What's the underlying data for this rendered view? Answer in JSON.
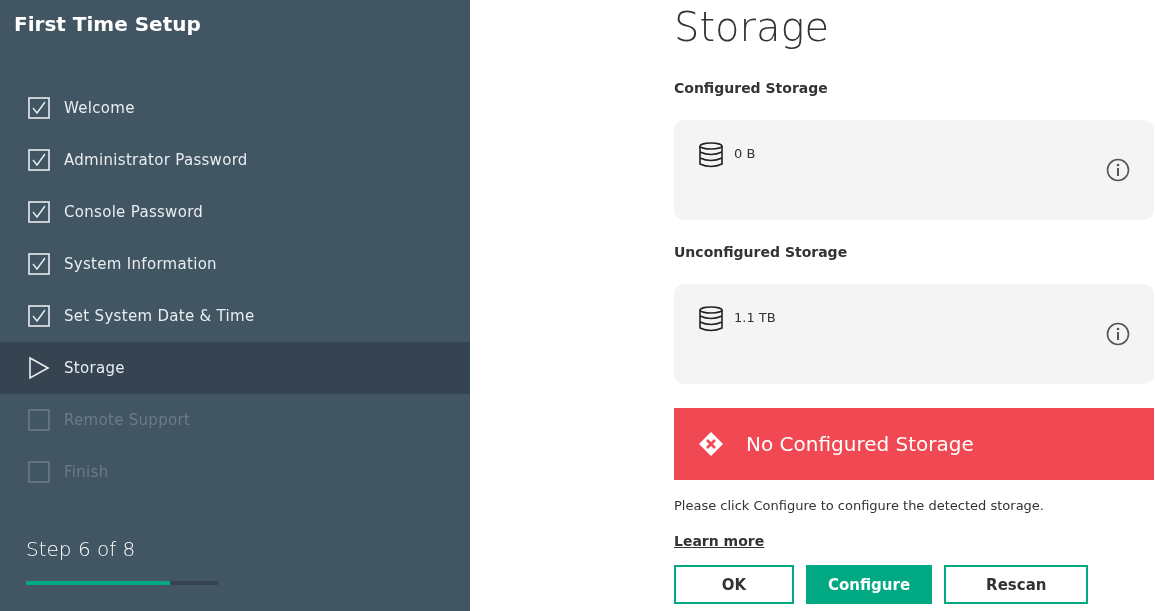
{
  "sidebar": {
    "title": "First Time Setup",
    "steps": [
      {
        "label": "Welcome",
        "kind": "done",
        "selected": false
      },
      {
        "label": "Administrator Password",
        "kind": "done",
        "selected": false
      },
      {
        "label": "Console Password",
        "kind": "done",
        "selected": false
      },
      {
        "label": "System Information",
        "kind": "done",
        "selected": false
      },
      {
        "label": "Set System Date & Time",
        "kind": "done",
        "selected": false
      },
      {
        "label": "Storage",
        "kind": "current",
        "selected": true
      },
      {
        "label": "Remote Support",
        "kind": "pending",
        "selected": false
      },
      {
        "label": "Finish",
        "kind": "pending",
        "selected": false
      }
    ],
    "progress": {
      "label": "Step 6 of 8",
      "level": 0.75
    }
  },
  "main": {
    "title": "Storage",
    "sections": [
      {
        "heading": "Configured Storage",
        "size": "0 B"
      },
      {
        "heading": "Unconfigured Storage",
        "size": "1.1 TB"
      }
    ],
    "alert": {
      "kind": "error",
      "message": "No Configured Storage"
    },
    "hint": "Please click Configure to configure the detected storage.",
    "link": "Learn more",
    "buttons": [
      {
        "label": "OK",
        "primary": false
      },
      {
        "label": "Configure",
        "primary": true
      },
      {
        "label": "Rescan",
        "primary": false
      }
    ]
  }
}
